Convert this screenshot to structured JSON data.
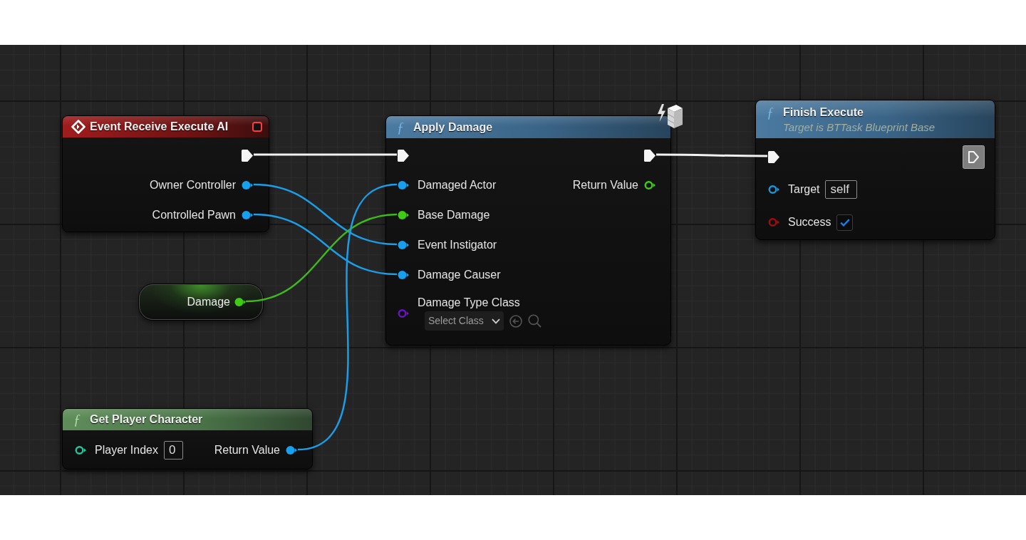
{
  "graph": {
    "nodes": [
      {
        "kind": "event",
        "title": "Event Receive Execute AI",
        "outputs": [
          {
            "kind": "exec",
            "connected": true
          },
          {
            "kind": "data",
            "label": "Owner Controller",
            "color": "#16a0ef",
            "connected": true
          },
          {
            "kind": "data",
            "label": "Controlled Pawn",
            "color": "#16a0ef",
            "connected": true
          }
        ]
      },
      {
        "kind": "function",
        "glyph": "ƒ",
        "title": "Apply Damage",
        "authority_only": true,
        "inputs": [
          {
            "kind": "exec",
            "connected": true
          },
          {
            "kind": "data",
            "label": "Damaged Actor",
            "color": "#16a0ef",
            "connected": true
          },
          {
            "kind": "data",
            "label": "Base Damage",
            "color": "#3fcb15",
            "connected": true
          },
          {
            "kind": "data",
            "label": "Event Instigator",
            "color": "#16a0ef",
            "connected": true
          },
          {
            "kind": "data",
            "label": "Damage Causer",
            "color": "#16a0ef",
            "connected": true
          },
          {
            "kind": "class_picker",
            "label": "Damage Type Class",
            "color": "#6a14c4",
            "connected": false,
            "value": "Select Class"
          }
        ],
        "outputs": [
          {
            "kind": "exec",
            "connected": true
          },
          {
            "kind": "data",
            "label": "Return Value",
            "color": "#3fcb15",
            "connected": false
          }
        ]
      },
      {
        "kind": "function",
        "glyph": "ƒ",
        "title": "Finish Execute",
        "subtitle": "Target is BTTask Blueprint Base",
        "inputs": [
          {
            "kind": "exec",
            "connected": true
          },
          {
            "kind": "text_field",
            "label": "Target",
            "color": "#1a96dc",
            "connected": false,
            "value": "self"
          },
          {
            "kind": "checkbox",
            "label": "Success",
            "color": "#9c1010",
            "connected": false,
            "checked": true
          }
        ],
        "outputs": [
          {
            "kind": "exec",
            "connected": false
          }
        ]
      },
      {
        "kind": "variable",
        "title": "Damage",
        "outputs": [
          {
            "kind": "data",
            "color": "#3fcb15",
            "connected": true
          }
        ]
      },
      {
        "kind": "pure_function",
        "glyph": "ƒ",
        "title": "Get Player Character",
        "inputs": [
          {
            "kind": "text_field",
            "label": "Player Index",
            "color": "#20c79c",
            "connected": false,
            "value": "0"
          }
        ],
        "outputs": [
          {
            "kind": "data",
            "label": "Return Value",
            "color": "#16a0ef",
            "connected": true
          }
        ]
      }
    ],
    "wires": [
      {
        "kind": "exec"
      },
      {
        "kind": "exec"
      },
      {
        "kind": "data",
        "color": "#1b9ee8"
      },
      {
        "kind": "data",
        "color": "#1b9ee8"
      },
      {
        "kind": "data",
        "color": "#3fb81c"
      },
      {
        "kind": "data",
        "color": "#1b9ee8"
      }
    ]
  }
}
